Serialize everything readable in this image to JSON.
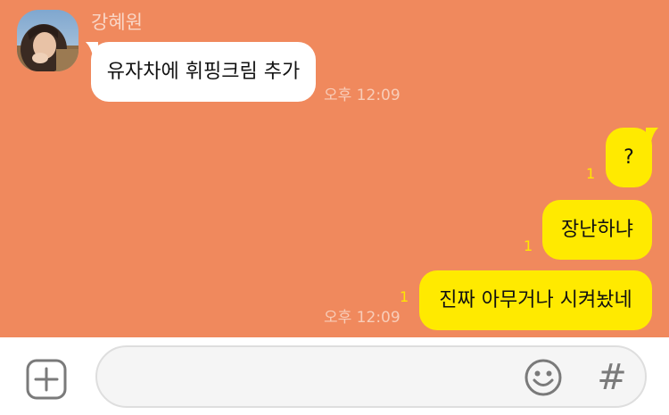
{
  "conversation": {
    "sender_name": "강혜원",
    "incoming": [
      {
        "text": "유자차에 휘핑크림 추가",
        "time": "오후 12:09"
      }
    ],
    "outgoing": [
      {
        "text": "?",
        "unread": "1"
      },
      {
        "text": "장난하냐",
        "unread": "1"
      },
      {
        "text": "진짜 아무거나 시켜놨네",
        "unread": "1",
        "time": "오후 12:09"
      }
    ]
  },
  "composer": {
    "placeholder": "",
    "plus_icon": "plus-icon",
    "emoji_icon": "smiley-icon",
    "hash_label": "#"
  },
  "colors": {
    "chat_background": "#f0895d",
    "outgoing_bubble": "#ffea00",
    "incoming_bubble": "#ffffff",
    "unread_count": "#ffe600"
  }
}
